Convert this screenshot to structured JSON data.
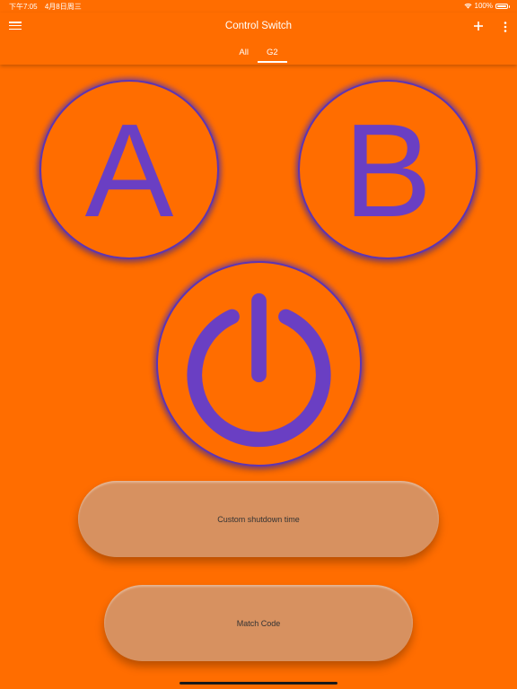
{
  "status_bar": {
    "time": "下午7:05",
    "date": "4月8日周三",
    "battery": "100%",
    "battery_level": 1.0
  },
  "app_bar": {
    "title": "Control Switch",
    "menu_icon": "menu-icon",
    "add_icon": "add-icon",
    "more_icon": "more-vertical-icon"
  },
  "tabs": [
    {
      "label": "All",
      "active": false
    },
    {
      "label": "G2",
      "active": true
    }
  ],
  "controls": {
    "button_a": "A",
    "button_b": "B",
    "power_icon": "power-icon",
    "custom_shutdown": "Custom shutdown time",
    "match_code": "Match Code"
  },
  "colors": {
    "background": "#FF6D00",
    "accent": "#6A3FC3",
    "pill": "#D79160"
  }
}
